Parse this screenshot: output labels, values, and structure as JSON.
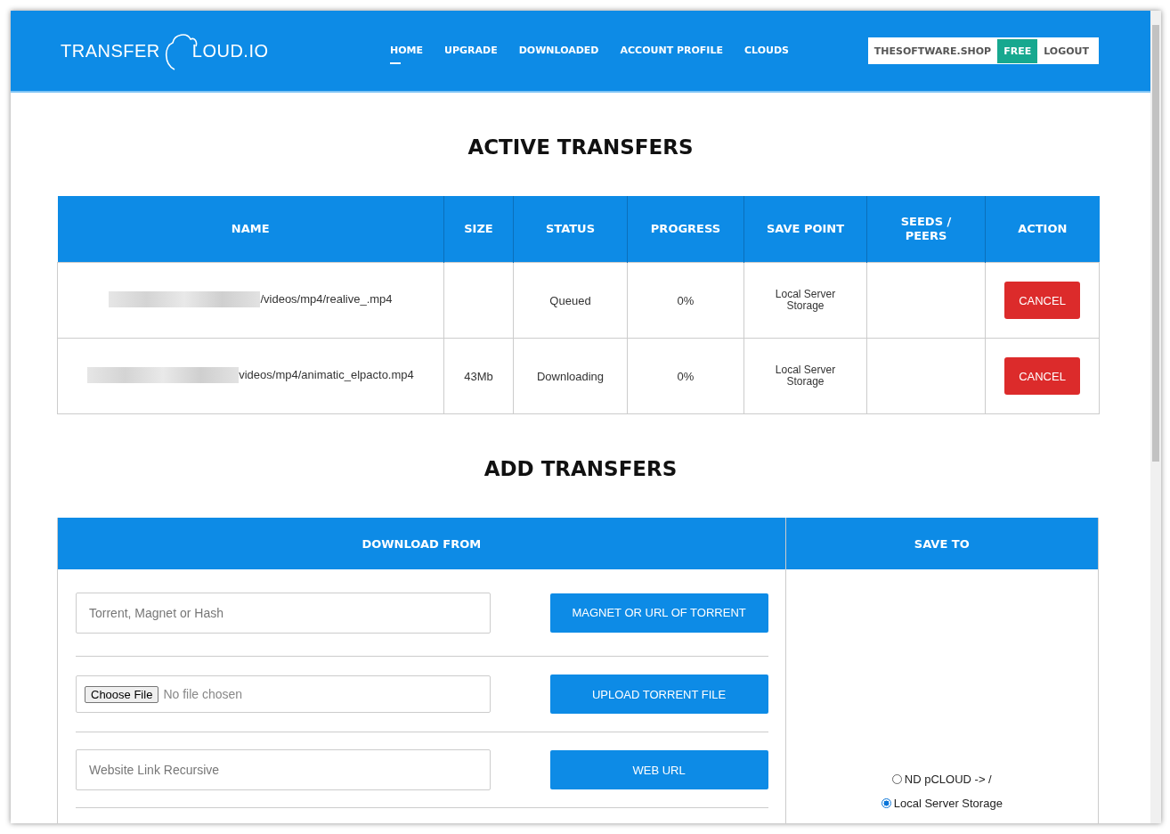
{
  "header": {
    "logo": {
      "left": "TRANSFER",
      "right": "LOUD.IO"
    },
    "nav": [
      {
        "label": "HOME",
        "selected": true
      },
      {
        "label": "UPGRADE",
        "selected": false
      },
      {
        "label": "DOWNLOADED",
        "selected": false
      },
      {
        "label": "ACCOUNT PROFILE",
        "selected": false
      },
      {
        "label": "CLOUDS",
        "selected": false
      }
    ],
    "account": {
      "site": "THESOFTWARE.SHOP",
      "plan": "FREE",
      "logout": "LOGOUT"
    }
  },
  "active_transfers": {
    "title": "ACTIVE TRANSFERS",
    "columns": [
      "NAME",
      "SIZE",
      "STATUS",
      "PROGRESS",
      "SAVE POINT",
      "SEEDS / PEERS",
      "ACTION"
    ],
    "rows": [
      {
        "name": "/videos/mp4/realive_.mp4",
        "redacted": true,
        "status": "Queued",
        "progress": "0%",
        "save_point": "Local Server Storage",
        "action": "CANCEL"
      },
      {
        "name": "videos/mp4/animatic_elpacto.mp4",
        "redacted": true,
        "size": "43Mb",
        "status": "Downloading",
        "progress": "0%",
        "save_point": "Local Server Storage",
        "action": "CANCEL"
      }
    ]
  },
  "add_transfers": {
    "title": "ADD TRANSFERS",
    "download_from": {
      "heading": "DOWNLOAD FROM",
      "rows": [
        {
          "kind": "text",
          "placeholder": "Torrent, Magnet or Hash",
          "button": "MAGNET OR URL OF TORRENT"
        },
        {
          "kind": "file",
          "file_button": "Choose File",
          "file_status": "No file chosen",
          "button": "UPLOAD TORRENT FILE"
        },
        {
          "kind": "text",
          "placeholder": "Website Link Recursive",
          "button": "WEB URL"
        }
      ]
    },
    "save_to": {
      "heading": "SAVE TO",
      "options": [
        {
          "label": "ND pCLOUD -> /",
          "selected": false
        },
        {
          "label": "Local Server Storage",
          "selected": true
        }
      ]
    }
  }
}
